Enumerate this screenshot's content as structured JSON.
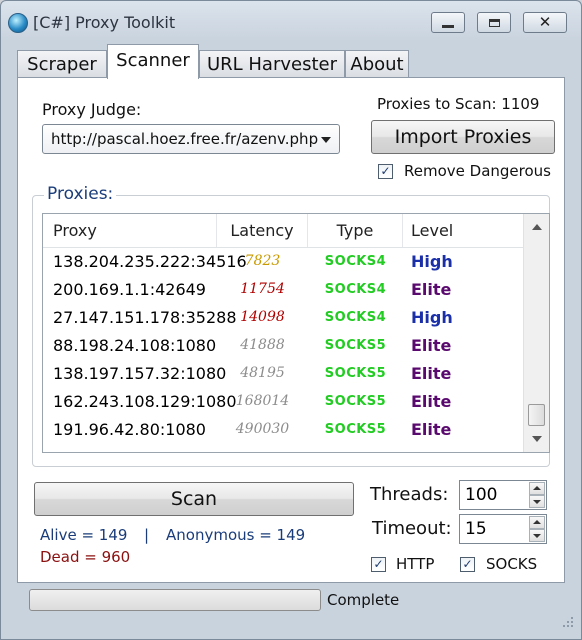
{
  "window": {
    "title": "[C#] Proxy Toolkit"
  },
  "tabs": [
    {
      "label": "Scraper"
    },
    {
      "label": "Scanner"
    },
    {
      "label": "URL Harvester"
    },
    {
      "label": "About"
    }
  ],
  "scanner": {
    "proxy_judge_label": "Proxy Judge:",
    "proxy_judge_value": "http://pascal.hoez.free.fr/azenv.php",
    "proxies_to_scan": "Proxies to Scan: 1109",
    "import_button": "Import Proxies",
    "remove_dangerous_label": "Remove Dangerous",
    "remove_dangerous_checked": true,
    "group_title": "Proxies:",
    "columns": [
      "Proxy",
      "Latency",
      "Type",
      "Level"
    ],
    "rows": [
      {
        "proxy": "138.204.235.222:34516",
        "latency": "7823",
        "latency_color": "#c99a00",
        "type": "SOCKS4",
        "level": "High",
        "level_color": "#1a2fa8"
      },
      {
        "proxy": "200.169.1.1:42649",
        "latency": "11754",
        "latency_color": "#b00000",
        "type": "SOCKS4",
        "level": "Elite",
        "level_color": "#5a0a6e"
      },
      {
        "proxy": "27.147.151.178:35288",
        "latency": "14098",
        "latency_color": "#b00000",
        "type": "SOCKS4",
        "level": "High",
        "level_color": "#1a2fa8"
      },
      {
        "proxy": "88.198.24.108:1080",
        "latency": "41888",
        "latency_color": "#8c8c8c",
        "type": "SOCKS5",
        "level": "Elite",
        "level_color": "#5a0a6e"
      },
      {
        "proxy": "138.197.157.32:1080",
        "latency": "48195",
        "latency_color": "#8c8c8c",
        "type": "SOCKS5",
        "level": "Elite",
        "level_color": "#5a0a6e"
      },
      {
        "proxy": "162.243.108.129:1080",
        "latency": "168014",
        "latency_color": "#8c8c8c",
        "type": "SOCKS5",
        "level": "Elite",
        "level_color": "#5a0a6e"
      },
      {
        "proxy": "191.96.42.80:1080",
        "latency": "490030",
        "latency_color": "#8c8c8c",
        "type": "SOCKS5",
        "level": "Elite",
        "level_color": "#5a0a6e"
      }
    ],
    "scan_button": "Scan",
    "alive": "Alive = 149",
    "separator": "|",
    "anonymous": "Anonymous = 149",
    "dead": "Dead = 960",
    "threads_label": "Threads:",
    "threads_value": "100",
    "timeout_label": "Timeout:",
    "timeout_value": "15",
    "http_label": "HTTP",
    "http_checked": true,
    "socks_label": "SOCKS",
    "socks_checked": true
  },
  "status": {
    "text": "Complete"
  },
  "colors": {
    "group_title": "#1a3d7a",
    "alive": "#1a3d7a",
    "dead": "#8b1010",
    "type": "#22cc22"
  }
}
